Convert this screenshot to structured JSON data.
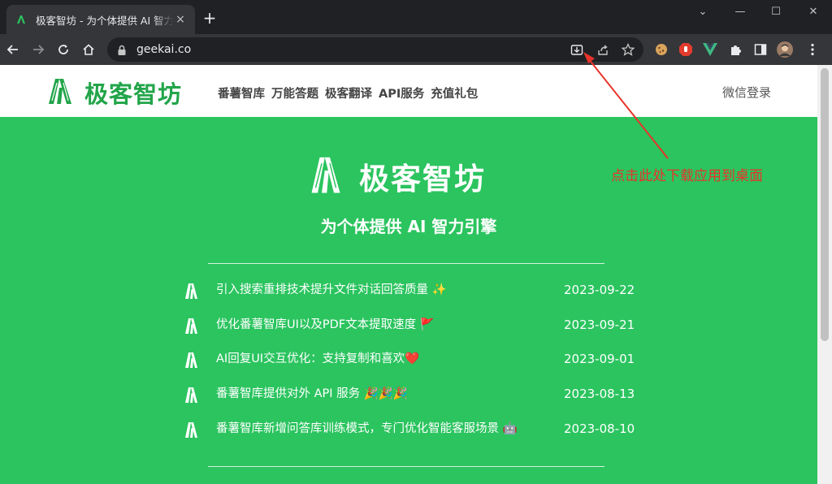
{
  "browser": {
    "tab_title": "极客智坊 - 为个体提供 AI 智力引擎",
    "tab_close": "×",
    "new_tab": "+",
    "url": "geekai.co",
    "window_controls": {
      "minimize": "—",
      "maximize": "☐",
      "close": "✕",
      "tabs_menu": "⌄"
    }
  },
  "site": {
    "brand": "极客智坊",
    "nav": [
      "番薯智库",
      "万能答题",
      "极客翻译",
      "API服务",
      "充值礼包"
    ],
    "login": "微信登录"
  },
  "hero": {
    "title": "极客智坊",
    "subtitle": "为个体提供 AI 智力引擎"
  },
  "news": [
    {
      "text": "引入搜索重排技术提升文件对话回答质量 ✨",
      "date": "2023-09-22"
    },
    {
      "text": "优化番薯智库UI以及PDF文本提取速度 🚩",
      "date": "2023-09-21"
    },
    {
      "text": "AI回复UI交互优化：支持复制和喜欢❤️",
      "date": "2023-09-01"
    },
    {
      "text": "番薯智库提供对外 API 服务 🎉🎉🎉",
      "date": "2023-08-13"
    },
    {
      "text": "番薯智库新增问答库训练模式，专门优化智能客服场景 🤖",
      "date": "2023-08-10"
    }
  ],
  "annotation": {
    "text": "点击此处下载应用到桌面",
    "color": "#e8332a"
  },
  "colors": {
    "brand_green": "#22a54a",
    "hero_bg": "#2bc45f"
  }
}
